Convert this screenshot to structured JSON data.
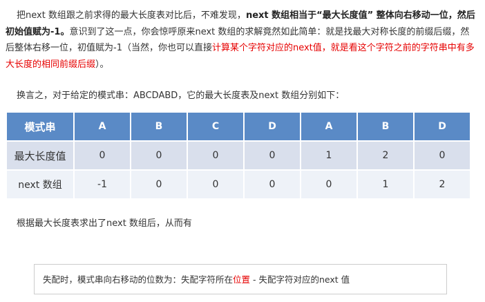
{
  "paragraph1": {
    "s1": "把next 数组跟之前求得的最大长度表对比后，不难发现，",
    "s2_bold": "next 数组相当于“最大长度值” 整体向右移动一位，然后初始值赋为-1。",
    "s3": "意识到了这一点，你会惊呼原来next 数组的求解竟然如此简单：就是找最大对称长度的前缀后缀，然后整体右移一位，初值赋为-1（当然，你也可以直接",
    "s4_red": "计算某个字符对应的next值，就是看这个字符之前的字符串中有多大长度的相同前缀后缀",
    "s5": "）。"
  },
  "paragraph2": "换言之，对于给定的模式串：ABCDABD，它的最大长度表及next 数组分别如下：",
  "table": {
    "header_label": "模式串",
    "header_chars": [
      "A",
      "B",
      "C",
      "D",
      "A",
      "B",
      "D"
    ],
    "rows": [
      {
        "label": "最大长度值",
        "values": [
          "0",
          "0",
          "0",
          "0",
          "1",
          "2",
          "0"
        ]
      },
      {
        "label": "next 数组",
        "values": [
          "-1",
          "0",
          "0",
          "0",
          "0",
          "1",
          "2"
        ]
      }
    ]
  },
  "paragraph3": "根据最大长度表求出了next 数组后，从而有",
  "formula": {
    "part1": "失配时，模式串向右移动的位数为：失配字符所在",
    "part2_red": "位置",
    "part3": " - 失配字符对应的next 值"
  }
}
